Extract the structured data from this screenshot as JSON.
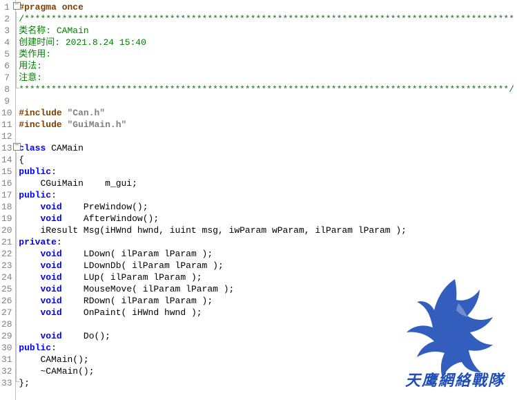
{
  "watermark_text": "天鹰網絡戰隊",
  "lines": [
    {
      "n": 1,
      "fold": "box",
      "segs": [
        {
          "c": "pp",
          "t": "#pragma once"
        }
      ]
    },
    {
      "n": 2,
      "fold": "line",
      "segs": [
        {
          "c": "cm",
          "t": "/*******************************************************************************************"
        }
      ]
    },
    {
      "n": 3,
      "fold": "line",
      "segs": [
        {
          "c": "cm",
          "t": "类名称: CAMain"
        }
      ]
    },
    {
      "n": 4,
      "fold": "line",
      "segs": [
        {
          "c": "cm",
          "t": "创建时间: 2021.8.24 15:40"
        }
      ]
    },
    {
      "n": 5,
      "fold": "line",
      "segs": [
        {
          "c": "cm",
          "t": "类作用:"
        }
      ]
    },
    {
      "n": 6,
      "fold": "line",
      "segs": [
        {
          "c": "cm",
          "t": "用法:"
        }
      ]
    },
    {
      "n": 7,
      "fold": "line",
      "segs": [
        {
          "c": "cm",
          "t": "注意:"
        }
      ]
    },
    {
      "n": 8,
      "fold": "end",
      "segs": [
        {
          "c": "cm",
          "t": "*******************************************************************************************/"
        }
      ]
    },
    {
      "n": 9,
      "fold": "",
      "segs": [
        {
          "c": "pl",
          "t": ""
        }
      ]
    },
    {
      "n": 10,
      "fold": "",
      "segs": [
        {
          "c": "pp",
          "t": "#include "
        },
        {
          "c": "str",
          "t": "\"Can.h\""
        }
      ]
    },
    {
      "n": 11,
      "fold": "",
      "segs": [
        {
          "c": "pp",
          "t": "#include "
        },
        {
          "c": "str",
          "t": "\"GuiMain.h\""
        }
      ]
    },
    {
      "n": 12,
      "fold": "",
      "segs": [
        {
          "c": "pl",
          "t": ""
        }
      ]
    },
    {
      "n": 13,
      "fold": "box",
      "segs": [
        {
          "c": "kw",
          "t": "class"
        },
        {
          "c": "pl",
          "t": " CAMain"
        }
      ]
    },
    {
      "n": 14,
      "fold": "line",
      "segs": [
        {
          "c": "pl",
          "t": "{"
        }
      ]
    },
    {
      "n": 15,
      "fold": "line",
      "segs": [
        {
          "c": "kw",
          "t": "public"
        },
        {
          "c": "pl",
          "t": ":"
        }
      ]
    },
    {
      "n": 16,
      "fold": "line",
      "segs": [
        {
          "c": "pl",
          "t": "    CGuiMain    m_gui;"
        }
      ]
    },
    {
      "n": 17,
      "fold": "line",
      "segs": [
        {
          "c": "kw",
          "t": "public"
        },
        {
          "c": "pl",
          "t": ":"
        }
      ]
    },
    {
      "n": 18,
      "fold": "line",
      "segs": [
        {
          "c": "pl",
          "t": "    "
        },
        {
          "c": "kw",
          "t": "void"
        },
        {
          "c": "pl",
          "t": "    PreWindow();"
        }
      ]
    },
    {
      "n": 19,
      "fold": "line",
      "segs": [
        {
          "c": "pl",
          "t": "    "
        },
        {
          "c": "kw",
          "t": "void"
        },
        {
          "c": "pl",
          "t": "    AfterWindow();"
        }
      ]
    },
    {
      "n": 20,
      "fold": "line",
      "segs": [
        {
          "c": "pl",
          "t": "    iResult Msg(iHWnd hwnd, iuint msg, iwParam wParam, ilParam lParam );"
        }
      ]
    },
    {
      "n": 21,
      "fold": "line",
      "segs": [
        {
          "c": "kw",
          "t": "private"
        },
        {
          "c": "pl",
          "t": ":"
        }
      ]
    },
    {
      "n": 22,
      "fold": "line",
      "segs": [
        {
          "c": "pl",
          "t": "    "
        },
        {
          "c": "kw",
          "t": "void"
        },
        {
          "c": "pl",
          "t": "    LDown( ilParam lParam );"
        }
      ]
    },
    {
      "n": 23,
      "fold": "line",
      "segs": [
        {
          "c": "pl",
          "t": "    "
        },
        {
          "c": "kw",
          "t": "void"
        },
        {
          "c": "pl",
          "t": "    LDownDb( ilParam lParam );"
        }
      ]
    },
    {
      "n": 24,
      "fold": "line",
      "segs": [
        {
          "c": "pl",
          "t": "    "
        },
        {
          "c": "kw",
          "t": "void"
        },
        {
          "c": "pl",
          "t": "    LUp( ilParam lParam );"
        }
      ]
    },
    {
      "n": 25,
      "fold": "line",
      "segs": [
        {
          "c": "pl",
          "t": "    "
        },
        {
          "c": "kw",
          "t": "void"
        },
        {
          "c": "pl",
          "t": "    MouseMove( ilParam lParam );"
        }
      ]
    },
    {
      "n": 26,
      "fold": "line",
      "segs": [
        {
          "c": "pl",
          "t": "    "
        },
        {
          "c": "kw",
          "t": "void"
        },
        {
          "c": "pl",
          "t": "    RDown( ilParam lParam );"
        }
      ]
    },
    {
      "n": 27,
      "fold": "line",
      "segs": [
        {
          "c": "pl",
          "t": "    "
        },
        {
          "c": "kw",
          "t": "void"
        },
        {
          "c": "pl",
          "t": "    OnPaint( iHWnd hwnd );"
        }
      ]
    },
    {
      "n": 28,
      "fold": "line",
      "segs": [
        {
          "c": "pl",
          "t": ""
        }
      ]
    },
    {
      "n": 29,
      "fold": "line",
      "segs": [
        {
          "c": "pl",
          "t": "    "
        },
        {
          "c": "kw",
          "t": "void"
        },
        {
          "c": "pl",
          "t": "    Do();"
        }
      ]
    },
    {
      "n": 30,
      "fold": "line",
      "segs": [
        {
          "c": "kw",
          "t": "public"
        },
        {
          "c": "pl",
          "t": ":"
        }
      ]
    },
    {
      "n": 31,
      "fold": "line",
      "segs": [
        {
          "c": "pl",
          "t": "    CAMain();"
        }
      ]
    },
    {
      "n": 32,
      "fold": "line",
      "segs": [
        {
          "c": "pl",
          "t": "    ~CAMain();"
        }
      ]
    },
    {
      "n": 33,
      "fold": "end",
      "segs": [
        {
          "c": "pl",
          "t": "};"
        }
      ]
    }
  ]
}
